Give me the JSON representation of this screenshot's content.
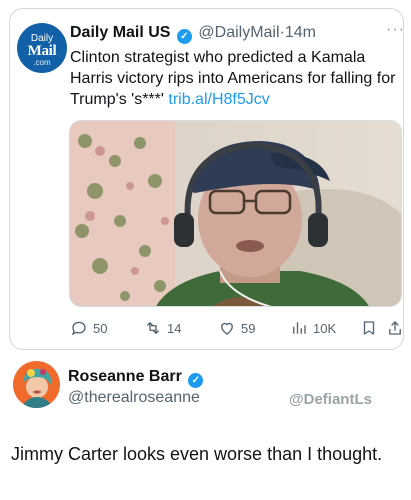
{
  "quoted_tweet": {
    "avatar_text": {
      "line1": "Daily",
      "line2": "Mail",
      "line3": ".com"
    },
    "display_name": "Daily Mail US",
    "verified_glyph": "✓",
    "handle": "@DailyMail",
    "separator": "·",
    "time": "14m",
    "more_glyph": "···",
    "text": "Clinton strategist who predicted a Kamala Harris victory rips into Americans for falling for Trump's 's***' ",
    "link": "trib.al/H8f5Jcv",
    "actions": {
      "replies": "50",
      "retweets": "14",
      "likes": "59",
      "views": "10K"
    }
  },
  "main_tweet": {
    "display_name": "Roseanne Barr",
    "verified_glyph": "✓",
    "handle": "@therealroseanne",
    "text": "Jimmy Carter looks even worse than I thought."
  },
  "watermark": "@DefiantLs",
  "colors": {
    "accent_blue": "#1d9bf0",
    "secondary_text": "#536471",
    "border": "#cfd9de",
    "daily_mail_blue": "#1260a8"
  },
  "icons": [
    "reply-icon",
    "retweet-icon",
    "like-icon",
    "views-icon",
    "bookmark-icon",
    "share-icon",
    "verified-badge-icon",
    "more-icon"
  ]
}
